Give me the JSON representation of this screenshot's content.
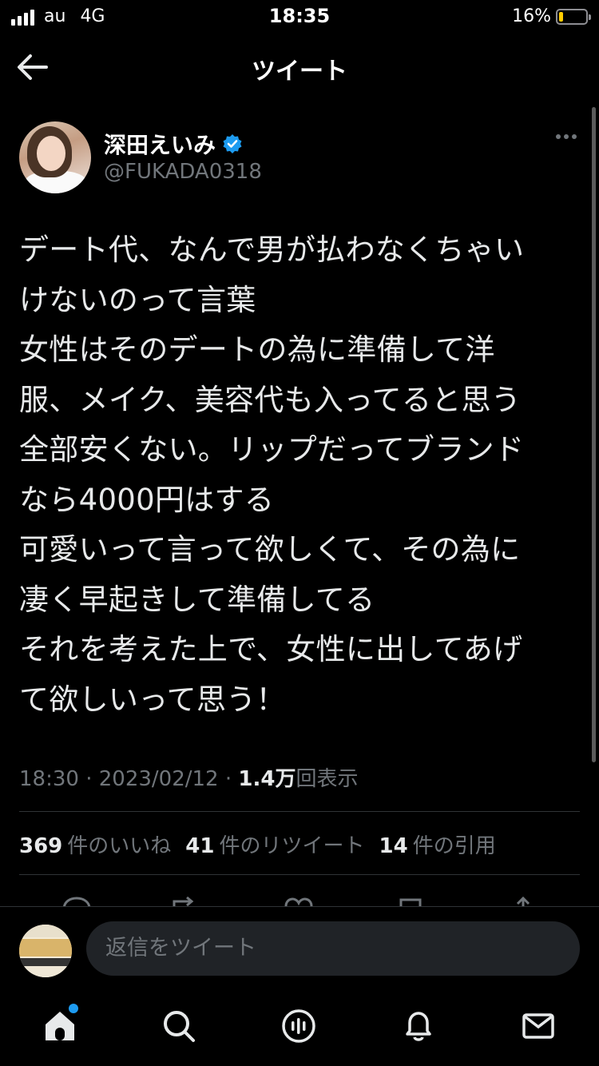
{
  "status_bar": {
    "carrier": "au",
    "network": "4G",
    "time": "18:35",
    "battery_percent": "16%",
    "battery_level": 0.16,
    "battery_color": "#ffcc00"
  },
  "header": {
    "title": "ツイート",
    "back_icon": "arrow-left-icon"
  },
  "tweet": {
    "author": {
      "display_name": "深田えいみ",
      "handle": "@FUKADA0318",
      "verified": true,
      "verified_color": "#1d9bf0"
    },
    "text_lines": [
      "デート代、なんで男が払わなくちゃい",
      "けないのって言葉",
      "女性はそのデートの為に準備して洋",
      "服、メイク、美容代も入ってると思う",
      "全部安くない。リップだってブランド",
      "なら4000円はする",
      "可愛いって言って欲しくて、その為に",
      "凄く早起きして準備してる",
      "それを考えた上で、女性に出してあげ",
      "て欲しいって思う！"
    ],
    "time": "18:30",
    "date": "2023/02/12",
    "separator": "·",
    "views_count": "1.4万",
    "views_label": "回表示",
    "likes_count": "369",
    "likes_label": "件のいいね",
    "retweets_count": "41",
    "retweets_label": "件のリツイート",
    "quotes_count": "14",
    "quotes_label": "件の引用"
  },
  "action_icons": [
    "reply-icon",
    "retweet-icon",
    "like-icon",
    "bookmark-icon",
    "share-icon"
  ],
  "reply_bar": {
    "placeholder": "返信をツイート"
  },
  "tab_bar": {
    "icons": [
      "home-icon",
      "search-icon",
      "spaces-icon",
      "notifications-icon",
      "messages-icon"
    ],
    "accent": "#1d9bf0"
  }
}
